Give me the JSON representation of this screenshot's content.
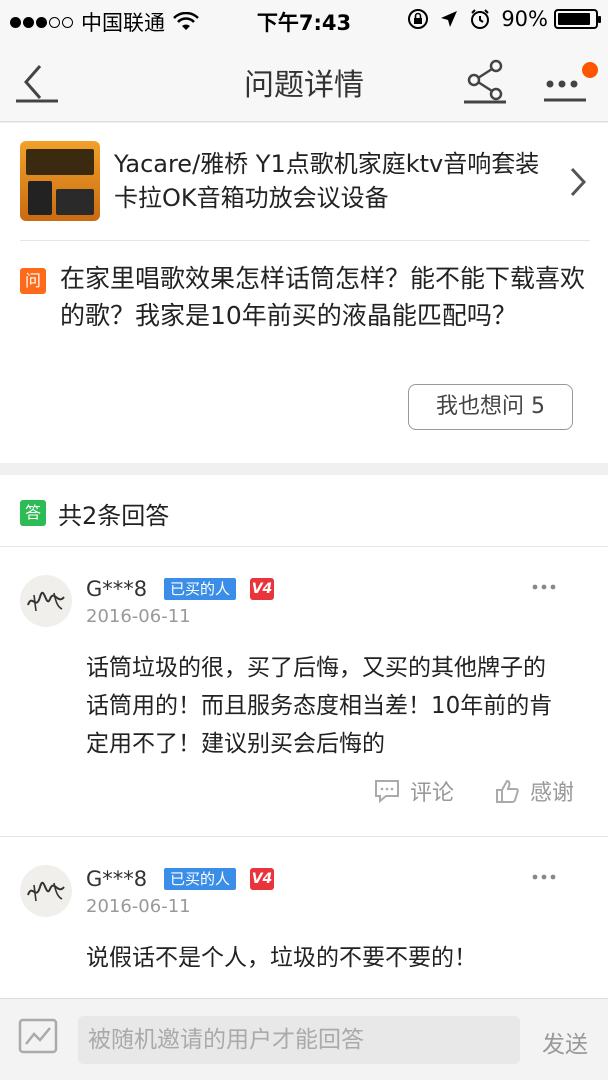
{
  "status_bar": {
    "carrier": "中国联通",
    "time": "下午7:43",
    "battery": "90%",
    "battery_level": 0.9
  },
  "nav": {
    "title": "问题详情",
    "icons": [
      "back-arrow-icon",
      "share-icon",
      "more-icon"
    ],
    "has_notification_dot": true
  },
  "product": {
    "title": "Yacare/雅桥 Y1点歌机家庭ktv音响套装卡拉OK音箱功放会议设备"
  },
  "question": {
    "badge": "问",
    "text": "在家里唱歌效果怎样话筒怎样？能不能下载喜欢的歌？我家是10年前买的液晶能匹配吗？",
    "also_ask_label": "我也想问 5"
  },
  "answers_header": {
    "badge": "答",
    "count_text": "共2条回答"
  },
  "answers": [
    {
      "user": "G***8",
      "buyer_tag": "已买的人",
      "level": "V4",
      "date": "2016-06-11",
      "text": "话筒垃圾的很，买了后悔，又买的其他牌子的话筒用的！而且服务态度相当差！10年前的肯定用不了！建议别买会后悔的",
      "comment_label": "评论",
      "thanks_label": "感谢"
    },
    {
      "user": "G***8",
      "buyer_tag": "已买的人",
      "level": "V4",
      "date": "2016-06-11",
      "text": "说假话不是个人，垃圾的不要不要的！"
    }
  ],
  "bottom_bar": {
    "placeholder": "被随机邀请的用户才能回答",
    "send_label": "发送"
  },
  "colors": {
    "question_badge": "#ff6a1a",
    "answer_badge": "#2dbb55",
    "buyer_tag": "#3b8ee8",
    "level_badge": "#e8343a",
    "notification_dot": "#ff5500"
  }
}
